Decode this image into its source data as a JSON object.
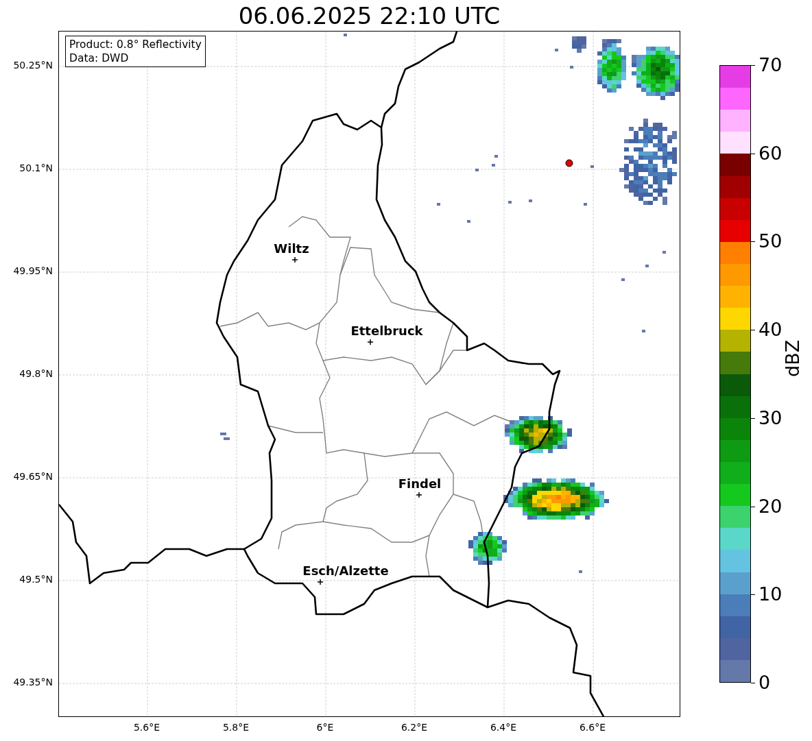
{
  "title": "06.06.2025 22:10 UTC",
  "info_box": {
    "lines": [
      "Product: 0.8° Reflectivity",
      "Data: DWD"
    ]
  },
  "x_ticks": [
    "5.6°E",
    "5.8°E",
    "6°E",
    "6.2°E",
    "6.4°E",
    "6.6°E"
  ],
  "y_ticks": [
    "50.25°N",
    "50.1°N",
    "49.95°N",
    "49.8°N",
    "49.65°N",
    "49.5°N",
    "49.35°N"
  ],
  "cities": [
    {
      "name": "Wiltz"
    },
    {
      "name": "Ettelbruck"
    },
    {
      "name": "Findel"
    },
    {
      "name": "Esch/Alzette"
    }
  ],
  "colorbar": {
    "label": "dBZ",
    "ticks": [
      "70",
      "60",
      "50",
      "40",
      "30",
      "20",
      "10",
      "0"
    ],
    "segments": [
      {
        "color": "#e63ce6"
      },
      {
        "color": "#ff66ff"
      },
      {
        "color": "#ffb3ff"
      },
      {
        "color": "#ffe0ff"
      },
      {
        "color": "#7a0000"
      },
      {
        "color": "#a00000"
      },
      {
        "color": "#c80000"
      },
      {
        "color": "#e60000"
      },
      {
        "color": "#ff7f00"
      },
      {
        "color": "#ff9900"
      },
      {
        "color": "#ffb300"
      },
      {
        "color": "#ffd700"
      },
      {
        "color": "#b3b300"
      },
      {
        "color": "#467a0a"
      },
      {
        "color": "#0a5a0a"
      },
      {
        "color": "#0a700a"
      },
      {
        "color": "#0a850a"
      },
      {
        "color": "#0f9a14"
      },
      {
        "color": "#10ae1a"
      },
      {
        "color": "#14c81e"
      },
      {
        "color": "#3cd26e"
      },
      {
        "color": "#5ad7c8"
      },
      {
        "color": "#64c3e1"
      },
      {
        "color": "#5aa0cd"
      },
      {
        "color": "#4b7db9"
      },
      {
        "color": "#4164a5"
      },
      {
        "color": "#5064a0"
      },
      {
        "color": "#6478aa"
      }
    ]
  }
}
